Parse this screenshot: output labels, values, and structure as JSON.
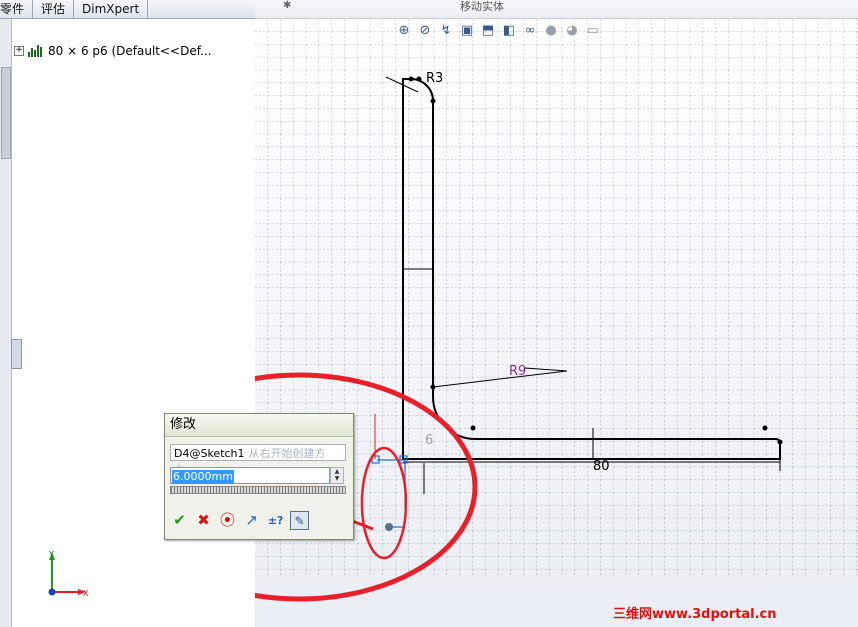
{
  "tabs": [
    "零件",
    "评估",
    "DimXpert"
  ],
  "top_strip": {
    "move_body_label": "移动实体"
  },
  "feature_tree": {
    "root_label": "80 × 6 p6  (Default<<Def..."
  },
  "view_toolbar": [
    "zoom-to-fit-icon",
    "zoom-area-icon",
    "previous-view-icon",
    "section-view-icon",
    "view-orientation-icon",
    "display-style-icon",
    "hide-show-icon",
    "edit-appearance-icon",
    "apply-scene-icon",
    "view-settings-icon"
  ],
  "sketch": {
    "dim_r3": "R3",
    "dim_r9": "R9",
    "dim_80": "80",
    "dim_6": "6"
  },
  "modify_dialog": {
    "title": "修改",
    "dimension_name": "D4@Sketch1",
    "hint": "从右开始创建方向...",
    "value": "6.0000mm"
  },
  "triad": {
    "x": "X",
    "y": "Y"
  },
  "watermark": "三维网www.3dportal.cn",
  "colors": {
    "annotation_red": "#e8202a",
    "sketch_line": "#000000",
    "dim_r9": "#8a2aa0",
    "selection_blue": "#1e6fd8"
  }
}
